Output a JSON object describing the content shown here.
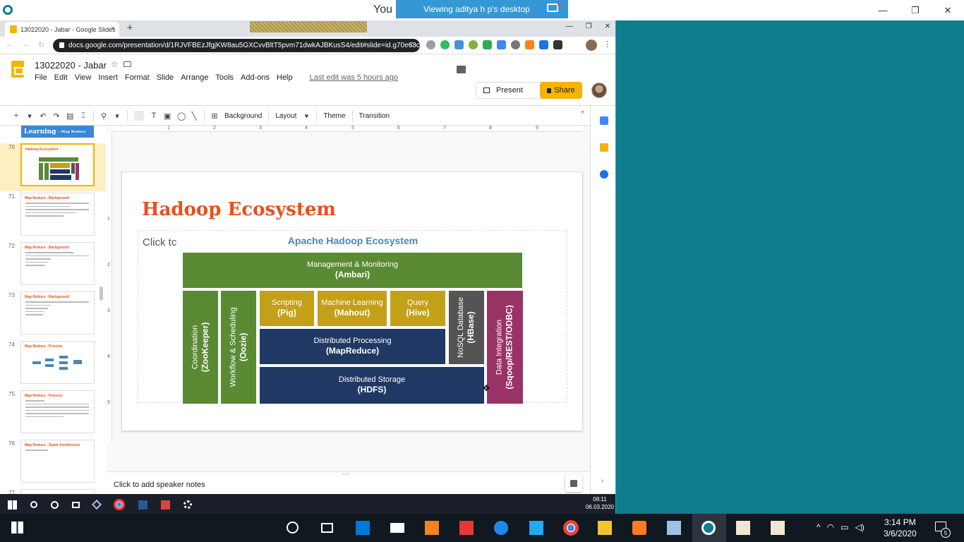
{
  "host": {
    "window_title": "You a",
    "banner": "Viewing aditya h p's desktop",
    "controls": [
      "—",
      "❐",
      "✕"
    ]
  },
  "browser": {
    "tab_title": "13022020 - Jabar - Google Slides",
    "tab_close": "×",
    "new_tab": "+",
    "window_controls": [
      "—",
      "❐",
      "✕"
    ],
    "url": "docs.google.com/presentation/d/1RJVFBEzJfgjKW8au5GXCvvBltT5pvm71dwkAJBKusS4/edit#slide=id.g70e63c...",
    "star": "☆"
  },
  "slides_app": {
    "doc_title": "13022020 - Jabar",
    "menu": [
      "File",
      "Edit",
      "View",
      "Insert",
      "Format",
      "Slide",
      "Arrange",
      "Tools",
      "Add-ons",
      "Help"
    ],
    "last_edit": "Last edit was 5 hours ago",
    "present_label": "Present",
    "share_label": "Share",
    "star_glyph": "☆"
  },
  "toolbar": {
    "background_label": "Background",
    "layout_label": "Layout",
    "theme_label": "Theme",
    "transition_label": "Transition",
    "caret": "▾",
    "collapse": "^"
  },
  "filmstrip": {
    "top_label": "Learning",
    "top_small": "– Map Reduce",
    "slides": [
      {
        "num": "70",
        "title": "Hadoop Ecosystem",
        "active": true
      },
      {
        "num": "71",
        "title": "Map Reduce - Background"
      },
      {
        "num": "72",
        "title": "Map Reduce - Background"
      },
      {
        "num": "73",
        "title": "Map Reduce - Background"
      },
      {
        "num": "74",
        "title": "Map Reduce - Process"
      },
      {
        "num": "75",
        "title": "Map Reduce - Process"
      },
      {
        "num": "76",
        "title": "Map Reduce - Spark Architecture"
      },
      {
        "num": "77",
        "title": ""
      }
    ]
  },
  "ruler": {
    "h_ticks": [
      "1",
      "2",
      "3",
      "4",
      "5",
      "6",
      "7",
      "8",
      "9"
    ],
    "v_ticks": [
      "1",
      "2",
      "3",
      "4",
      "5"
    ]
  },
  "slide": {
    "title": "Hadoop Ecosystem",
    "placeholder": "Click tc",
    "ecosystem": {
      "heading": "Apache Hadoop Ecosystem",
      "management": {
        "line1": "Management & Monitoring",
        "line2": "(Ambari)"
      },
      "coordination": {
        "line1": "Coordination",
        "line2": "(ZooKeeper)"
      },
      "workflow": {
        "line1": "Workflow & Scheduling",
        "line2": "(Oozie)"
      },
      "scripting": {
        "line1": "Scripting",
        "line2": "(Pig)"
      },
      "ml": {
        "line1": "Machine Learning",
        "line2": "(Mahout)"
      },
      "query": {
        "line1": "Query",
        "line2": "(Hive)"
      },
      "nosql": {
        "line1": "NoSQL Database",
        "line2": "(HBase)"
      },
      "processing": {
        "line1": "Distributed Processing",
        "line2": "(MapReduce)"
      },
      "storage": {
        "line1": "Distributed Storage",
        "line2": "(HDFS)"
      },
      "integration": {
        "line1": "Data Integration",
        "line2": "(Sqoop/REST/ODBC)"
      }
    },
    "cursor_glyph": "✥"
  },
  "notes": {
    "placeholder": "Click to add speaker notes",
    "handle": "• • •"
  },
  "side_panel": {
    "expand": "›"
  },
  "remote_taskbar": {
    "time": "08:11",
    "date": "06.03.2020"
  },
  "host_taskbar": {
    "time": "3:14 PM",
    "date": "3/6/2020",
    "notification_count": "5",
    "tray": [
      "^",
      "◠",
      "▭",
      "◁)"
    ]
  },
  "colors": {
    "accent_yellow": "#f4b400",
    "title_orange": "#e8501c",
    "eco_green": "#5b8a35",
    "eco_olive": "#c3a017",
    "eco_navy": "#1f3864",
    "eco_gray": "#545454",
    "eco_magenta": "#993366"
  }
}
